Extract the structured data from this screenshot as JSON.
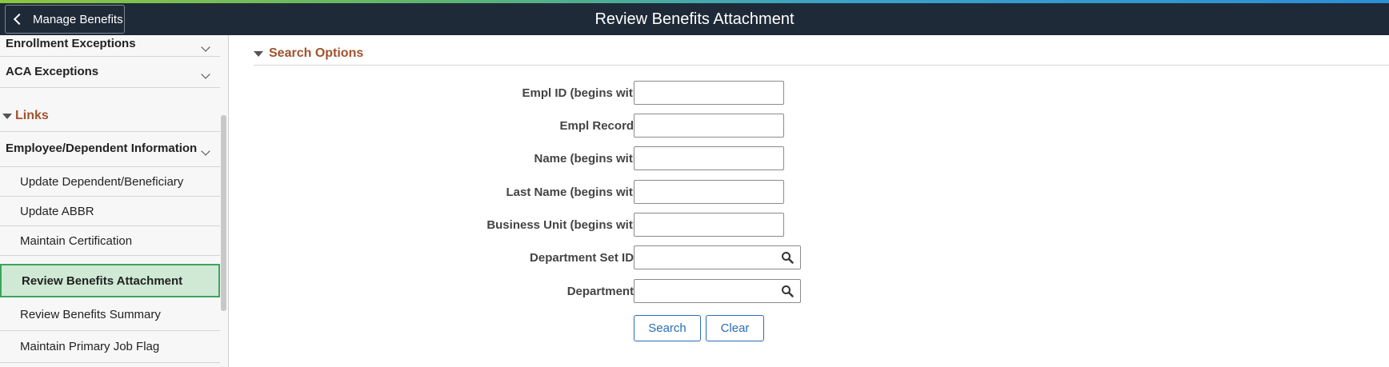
{
  "header": {
    "back_label": "Manage Benefits",
    "title": "Review Benefits Attachment"
  },
  "sidebar": {
    "sections": [
      {
        "label": "Enrollment Exceptions"
      },
      {
        "label": "ACA Exceptions"
      }
    ],
    "links_header": "Links",
    "group": {
      "label": "Employee/Dependent Information"
    },
    "items": [
      {
        "label": "Update Dependent/Beneficiary"
      },
      {
        "label": "Update ABBR"
      },
      {
        "label": "Maintain Certification"
      },
      {
        "label": "Review Benefits Attachment",
        "active": true
      },
      {
        "label": "Review Benefits Summary"
      },
      {
        "label": "Maintain Primary Job Flag"
      }
    ]
  },
  "search": {
    "header": "Search Options",
    "fields": [
      {
        "label": "Empl ID (begins with)",
        "value": ""
      },
      {
        "label": "Empl Record =",
        "value": ""
      },
      {
        "label": "Name (begins with)",
        "value": ""
      },
      {
        "label": "Last Name (begins with)",
        "value": ""
      },
      {
        "label": "Business Unit (begins with)",
        "value": ""
      },
      {
        "label": "Department Set ID =",
        "value": "",
        "lookup_icon": "search-icon"
      },
      {
        "label": "Department =",
        "value": "",
        "lookup_icon": "search-icon"
      }
    ],
    "search_button": "Search",
    "clear_button": "Clear"
  },
  "colors": {
    "header_bg": "#1f2a38",
    "section_title": "#a0522d",
    "button_text": "#2a6db5",
    "active_item_bg": "#cfe9d5",
    "active_item_border": "#3aa55a"
  }
}
